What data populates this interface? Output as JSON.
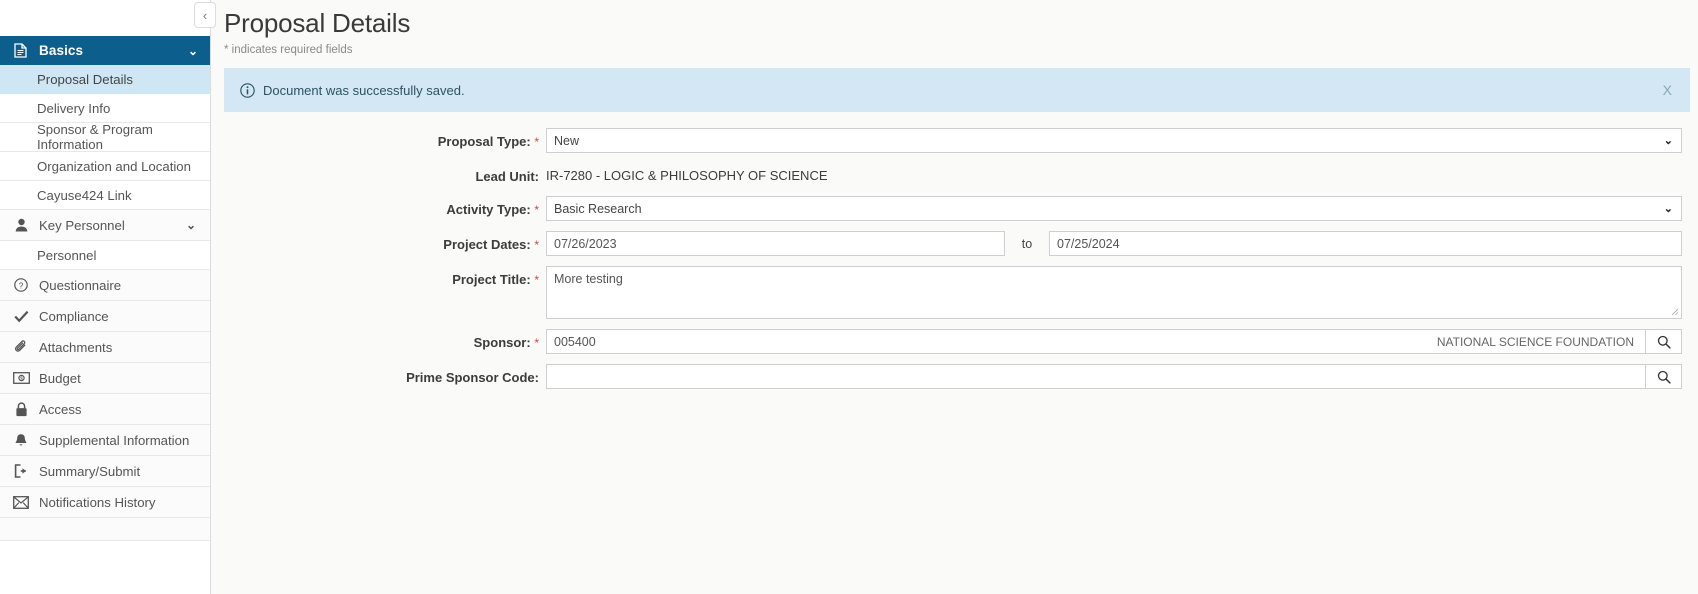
{
  "sidebar": {
    "collapse_button_label": "‹",
    "groups": [
      {
        "label": "Basics",
        "icon": "document-icon",
        "caret": "⌄",
        "items": [
          {
            "label": "Proposal Details",
            "active": true
          },
          {
            "label": "Delivery Info",
            "active": false
          },
          {
            "label": "Sponsor & Program Information",
            "active": false
          },
          {
            "label": "Organization and Location",
            "active": false
          },
          {
            "label": "Cayuse424 Link",
            "active": false
          }
        ]
      },
      {
        "label": "Key Personnel",
        "icon": "person-icon",
        "caret": "⌄",
        "items": [
          {
            "label": "Personnel",
            "active": false
          }
        ]
      }
    ],
    "items": [
      {
        "label": "Questionnaire",
        "icon": "question-circle-icon"
      },
      {
        "label": "Compliance",
        "icon": "check-icon"
      },
      {
        "label": "Attachments",
        "icon": "paperclip-icon"
      },
      {
        "label": "Budget",
        "icon": "money-icon"
      },
      {
        "label": "Access",
        "icon": "lock-icon"
      },
      {
        "label": "Supplemental Information",
        "icon": "bell-icon"
      },
      {
        "label": "Summary/Submit",
        "icon": "sign-out-icon"
      },
      {
        "label": "Notifications History",
        "icon": "envelope-icon"
      }
    ]
  },
  "page": {
    "title": "Proposal Details",
    "required_note": "* indicates required fields"
  },
  "alert": {
    "icon": "info-circle-icon",
    "message": "Document was successfully saved.",
    "close_label": "X"
  },
  "form": {
    "proposal_type": {
      "label": "Proposal Type:",
      "required": "*",
      "value": "New",
      "caret": "⌄"
    },
    "lead_unit": {
      "label": "Lead Unit:",
      "value": "IR-7280 - LOGIC & PHILOSOPHY OF SCIENCE"
    },
    "activity_type": {
      "label": "Activity Type:",
      "required": "*",
      "value": "Basic Research",
      "caret": "⌄"
    },
    "project_dates": {
      "label": "Project Dates:",
      "required": "*",
      "start": "07/26/2023",
      "separator": "to",
      "end": "07/25/2024"
    },
    "project_title": {
      "label": "Project Title:",
      "required": "*",
      "value": "More testing"
    },
    "sponsor": {
      "label": "Sponsor:",
      "required": "*",
      "code": "005400",
      "name": "NATIONAL SCIENCE FOUNDATION",
      "lookup_icon": "search-icon"
    },
    "prime_sponsor_code": {
      "label": "Prime Sponsor Code:",
      "value": "",
      "lookup_icon": "search-icon"
    }
  },
  "colors": {
    "group_header_bg": "#0c5e8c",
    "active_item_bg": "#cfe7f5",
    "alert_bg": "#d3e8f4",
    "required_star": "#d64545",
    "page_bg": "#fafaf8"
  }
}
